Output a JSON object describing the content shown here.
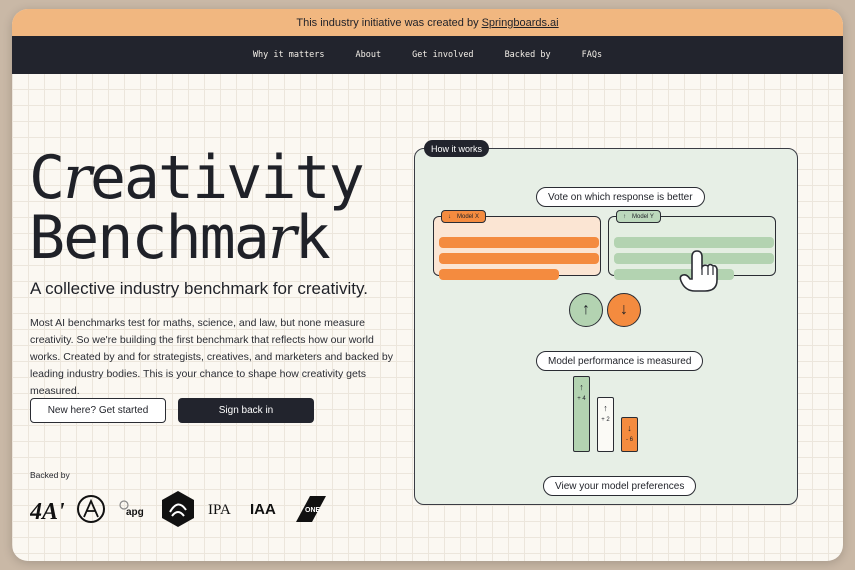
{
  "banner": {
    "text": "This industry initiative was created by",
    "link": "Springboards.ai"
  },
  "nav": {
    "items": [
      "Why it matters",
      "About",
      "Get involved",
      "Backed by",
      "FAQs"
    ]
  },
  "hero": {
    "title_line1_prefix": "C",
    "title_line1_accent": "r",
    "title_line1_suffix": "eativity",
    "title_line2_prefix": "Benchma",
    "title_line2_accent": "r",
    "title_line2_suffix": "k",
    "subtitle": "A collective industry benchmark for creativity.",
    "description": "Most AI benchmarks test for maths, science, and law, but none measure creativity. So we're building the first benchmark that reflects how our world works. Created by and for strategists, creatives, and marketers and backed by leading industry bodies. This is your chance to shape how creativity gets measured.",
    "primary_button": "New here? Get started",
    "secondary_button": "Sign back in"
  },
  "backed": {
    "label": "Backed by",
    "logos": [
      {
        "name": "4as-logo",
        "text": "4A's"
      },
      {
        "name": "aa-logo",
        "text": ""
      },
      {
        "name": "apg-logo",
        "text": "apg"
      },
      {
        "name": "dad-logo",
        "text": ""
      },
      {
        "name": "ipa-logo",
        "text": "IPA"
      },
      {
        "name": "iaa-logo",
        "text": "IAA"
      },
      {
        "name": "one-club-logo",
        "text": "ONE"
      }
    ]
  },
  "how_it_works": {
    "tag": "How it works",
    "step1": "Vote on which response is better",
    "model_x": "Model X",
    "model_y": "Model Y",
    "step2": "Model performance is measured",
    "col1_value": "+ 4",
    "col2_value": "+ 2",
    "col3_value": "- 6",
    "step3": "View your model preferences"
  },
  "colors": {
    "banner": "#f1b780",
    "nav": "#22242d",
    "orange": "#f48b3f",
    "green": "#b3d3b1"
  }
}
